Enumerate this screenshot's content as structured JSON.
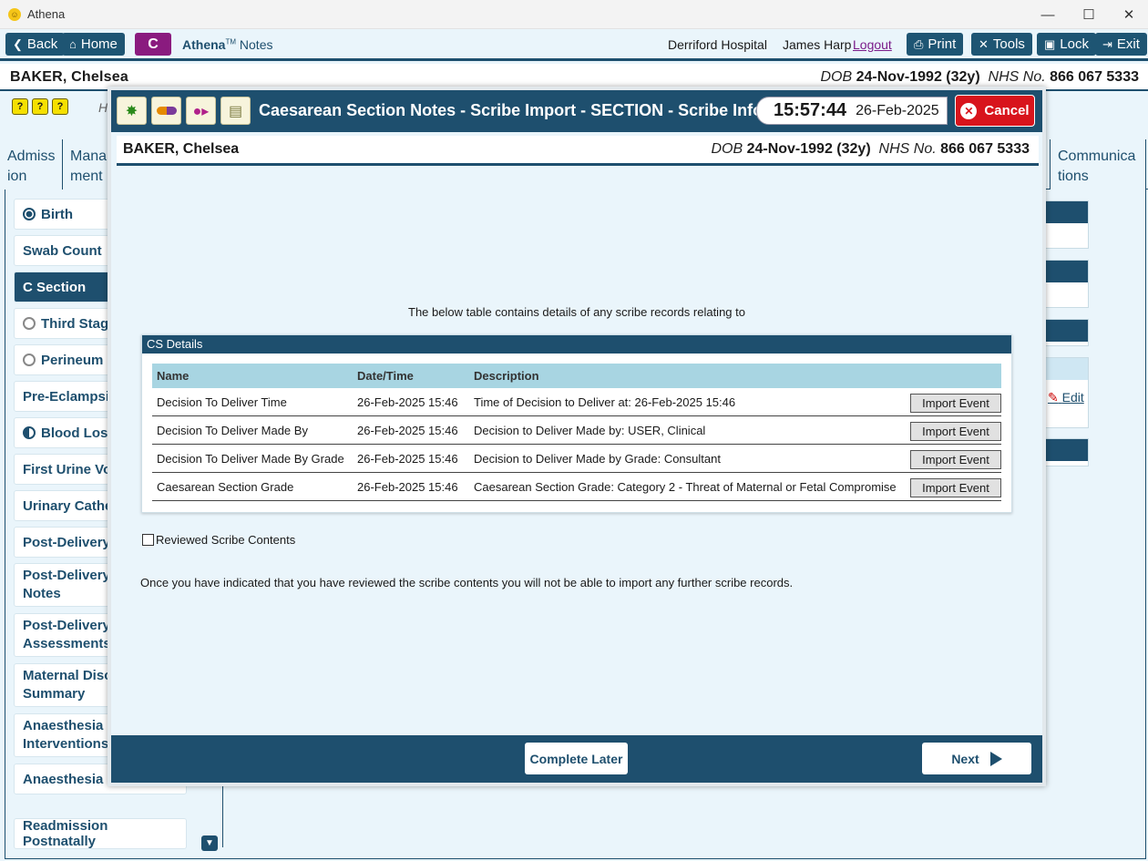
{
  "window": {
    "title": "Athena",
    "minimize": "—",
    "maximize": "☐",
    "close": "✕"
  },
  "toolbar": {
    "back": "Back",
    "home": "Home",
    "badge": "C",
    "brand_name": "Athena",
    "brand_tm": "TM",
    "brand_suffix": "Notes",
    "hospital": "Derriford Hospital",
    "user": "James Harp",
    "logout": "Logout",
    "print": "Print",
    "tools": "Tools",
    "lock": "Lock",
    "exit": "Exit"
  },
  "patient": {
    "name": "BAKER, Chelsea",
    "dob_label": "DOB",
    "dob": "24-Nov-1992 (32y)",
    "nhs_label": "NHS No.",
    "nhs": "866 067 5333"
  },
  "behind": {
    "help_icons": [
      "?",
      "?",
      "?"
    ],
    "letter_h": "H",
    "tabs": [
      {
        "line1": "Admiss",
        "line2": "ion"
      },
      {
        "line1": "Mana",
        "line2": "ment"
      },
      {
        "line1": "Communica",
        "line2": "tions"
      }
    ],
    "sidebar": [
      {
        "label": "Birth",
        "radio": "filled"
      },
      {
        "label": "Swab Count",
        "radio": "none"
      },
      {
        "label": "C Section",
        "radio": "none",
        "active": true
      },
      {
        "label": "Third Stage",
        "radio": "empty"
      },
      {
        "label": "Perineum",
        "radio": "empty"
      },
      {
        "label": "Pre-Eclampsia",
        "radio": "none"
      },
      {
        "label": "Blood Loss",
        "radio": "half"
      },
      {
        "label": "First Urine Voi",
        "radio": "none"
      },
      {
        "label": "Urinary Cathe",
        "radio": "none"
      },
      {
        "label": "Post-Delivery",
        "radio": "none"
      },
      {
        "label": "Post-Delivery Notes",
        "radio": "none"
      },
      {
        "label": "Post-Delivery Assessments",
        "radio": "none"
      },
      {
        "label": "Maternal Disc Summary",
        "radio": "none"
      },
      {
        "label": "Anaesthesia Interventions",
        "radio": "none"
      },
      {
        "label": "Anaesthesia Fo",
        "radio": "none"
      },
      {
        "label": "Readmission Postnatally",
        "radio": "none"
      }
    ],
    "edit": "Edit"
  },
  "modal": {
    "title": "Caesarean Section Notes - Scribe Import - SECTION - Scribe Info",
    "time": "15:57:44",
    "date": "26-Feb-2025",
    "cancel": "Cancel",
    "intro": "The below table contains details of any scribe records relating to",
    "panel_title": "CS Details",
    "columns": [
      "Name",
      "Date/Time",
      "Description"
    ],
    "rows": [
      {
        "name": "Decision To Deliver Time",
        "datetime": "26-Feb-2025 15:46",
        "description": "Time of Decision to Deliver at: 26-Feb-2025 15:46",
        "action": "Import Event"
      },
      {
        "name": "Decision To Deliver Made By",
        "datetime": "26-Feb-2025 15:46",
        "description": "Decision to Deliver Made by: USER, Clinical",
        "action": "Import Event"
      },
      {
        "name": "Decision To Deliver Made By Grade",
        "datetime": "26-Feb-2025 15:46",
        "description": "Decision to Deliver Made by Grade: Consultant",
        "action": "Import Event"
      },
      {
        "name": "Caesarean Section Grade",
        "datetime": "26-Feb-2025 15:46",
        "description": "Caesarean Section Grade: Category 2 - Threat of Maternal or Fetal Compromise",
        "action": "Import Event"
      }
    ],
    "reviewed_label": "Reviewed Scribe Contents",
    "note": "Once you have indicated that you have reviewed the scribe contents you will not be able to import any further scribe records.",
    "complete_later": "Complete Later",
    "next": "Next"
  },
  "colors": {
    "primary": "#1e4f6e",
    "cancel": "#d8141c",
    "badge": "#8a1b7f",
    "grid_header": "#a8d5e2"
  }
}
